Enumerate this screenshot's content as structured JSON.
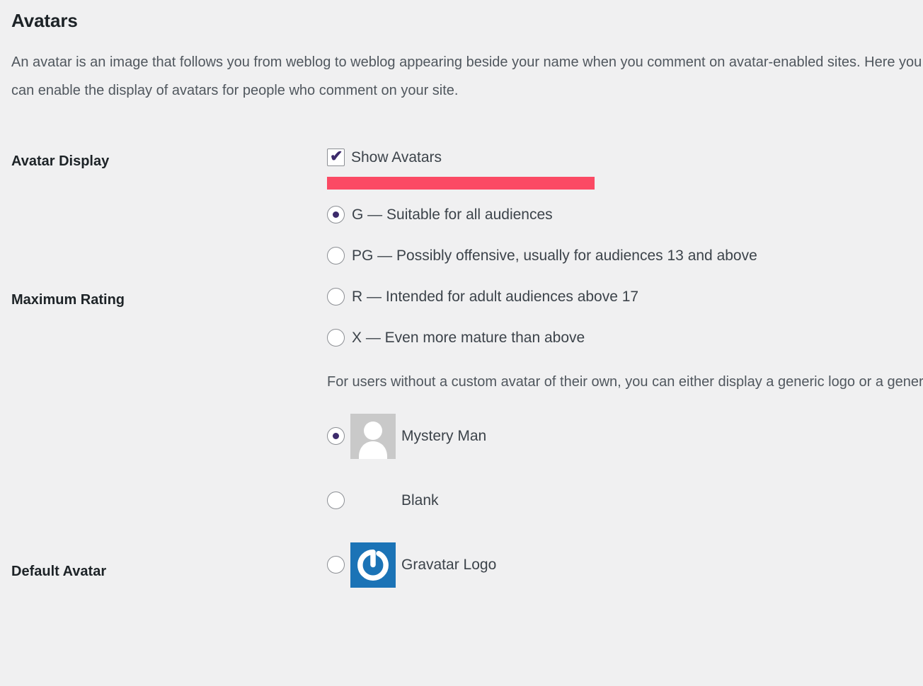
{
  "page": {
    "title": "Avatars",
    "description": "An avatar is an image that follows you from weblog to weblog appearing beside your name when you comment on avatar-enabled sites. Here you can enable the display of avatars for people who comment on your site."
  },
  "avatar_display": {
    "label": "Avatar Display",
    "checkbox_label": "Show Avatars",
    "checked": true,
    "check_glyph": "✔",
    "highlight_color": "#fb4a64"
  },
  "maximum_rating": {
    "label": "Maximum Rating",
    "options": [
      {
        "value": "G",
        "label": "G — Suitable for all audiences",
        "selected": true
      },
      {
        "value": "PG",
        "label": "PG — Possibly offensive, usually for audiences 13 and above",
        "selected": false
      },
      {
        "value": "R",
        "label": "R — Intended for adult audiences above 17",
        "selected": false
      },
      {
        "value": "X",
        "label": "X — Even more mature than above",
        "selected": false
      }
    ]
  },
  "default_avatar": {
    "label": "Default Avatar",
    "description": "For users without a custom avatar of their own, you can either display a generic logo or a generated one based on their email address.",
    "options": [
      {
        "label": "Mystery Man",
        "icon": "mystery-man-avatar-icon",
        "selected": true
      },
      {
        "label": "Blank",
        "icon": "blank-avatar-icon",
        "selected": false
      },
      {
        "label": "Gravatar Logo",
        "icon": "gravatar-logo-icon",
        "selected": false
      }
    ]
  },
  "colors": {
    "background": "#f0f0f1",
    "accent": "#3c2a6b",
    "gravatar_blue": "#1b73b6",
    "mystery_gray": "#c9c9c9",
    "marker_red": "#fb4a64"
  }
}
